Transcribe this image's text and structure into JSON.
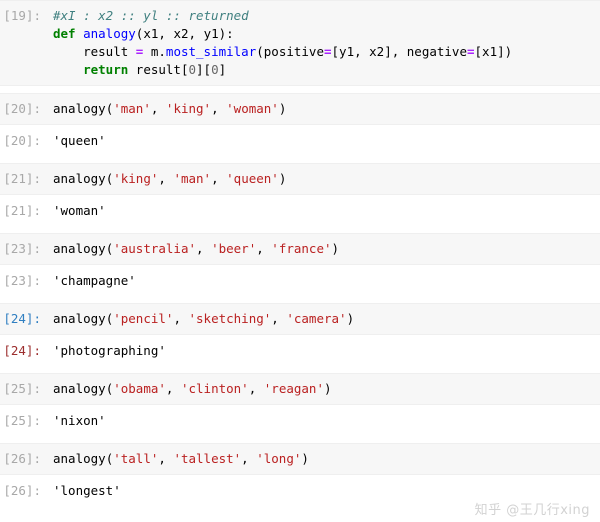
{
  "notebook": {
    "watermark": "知乎 @王几行xing",
    "colors": {
      "input_background": "#f7f7f7",
      "output_background": "#ffffff",
      "prompt_default": "#a8a8a8",
      "prompt_active_input": "#307fc1",
      "prompt_active_output": "#9c2e2e",
      "comment": "#408080",
      "keyword": "#008000",
      "function_name": "#0000ff",
      "string": "#ba2121",
      "operator": "#aa22ff",
      "number": "#666666",
      "watermark": "#d2d2d2"
    },
    "cells": [
      {
        "type": "input",
        "prompt": "[19]:",
        "active": false,
        "lines": [
          [
            {
              "t": "#xI : x2 :: yl :: returned",
              "c": "tok-c"
            }
          ],
          [
            {
              "t": "def",
              "c": "tok-k"
            },
            {
              "t": " ",
              "c": "tok-p"
            },
            {
              "t": "analogy",
              "c": "tok-nf"
            },
            {
              "t": "(",
              "c": "tok-p"
            },
            {
              "t": "x1",
              "c": "tok-n"
            },
            {
              "t": ", ",
              "c": "tok-p"
            },
            {
              "t": "x2",
              "c": "tok-n"
            },
            {
              "t": ", ",
              "c": "tok-p"
            },
            {
              "t": "y1",
              "c": "tok-n"
            },
            {
              "t": "):",
              "c": "tok-p"
            }
          ],
          [
            {
              "t": "    result ",
              "c": "tok-n"
            },
            {
              "t": "=",
              "c": "tok-o"
            },
            {
              "t": " m",
              "c": "tok-n"
            },
            {
              "t": ".",
              "c": "tok-p"
            },
            {
              "t": "most_similar",
              "c": "tok-nf"
            },
            {
              "t": "(",
              "c": "tok-p"
            },
            {
              "t": "positive",
              "c": "tok-na"
            },
            {
              "t": "=",
              "c": "tok-o"
            },
            {
              "t": "[y1, x2], ",
              "c": "tok-p"
            },
            {
              "t": "negative",
              "c": "tok-na"
            },
            {
              "t": "=",
              "c": "tok-o"
            },
            {
              "t": "[x1])",
              "c": "tok-p"
            }
          ],
          [
            {
              "t": "    ",
              "c": "tok-p"
            },
            {
              "t": "return",
              "c": "tok-k"
            },
            {
              "t": " result",
              "c": "tok-n"
            },
            {
              "t": "[",
              "c": "tok-p"
            },
            {
              "t": "0",
              "c": "tok-mi"
            },
            {
              "t": "][",
              "c": "tok-p"
            },
            {
              "t": "0",
              "c": "tok-mi"
            },
            {
              "t": "]",
              "c": "tok-p"
            }
          ]
        ]
      },
      {
        "type": "input",
        "prompt": "[20]:",
        "active": false,
        "lines": [
          [
            {
              "t": "analogy",
              "c": "tok-n"
            },
            {
              "t": "(",
              "c": "tok-p"
            },
            {
              "t": "'man'",
              "c": "tok-s"
            },
            {
              "t": ", ",
              "c": "tok-p"
            },
            {
              "t": "'king'",
              "c": "tok-s"
            },
            {
              "t": ", ",
              "c": "tok-p"
            },
            {
              "t": "'woman'",
              "c": "tok-s"
            },
            {
              "t": ")",
              "c": "tok-p"
            }
          ]
        ]
      },
      {
        "type": "output",
        "prompt": "[20]:",
        "active": false,
        "lines": [
          [
            {
              "t": "'queen'",
              "c": "tok-p"
            }
          ]
        ]
      },
      {
        "type": "input",
        "prompt": "[21]:",
        "active": false,
        "lines": [
          [
            {
              "t": "analogy",
              "c": "tok-n"
            },
            {
              "t": "(",
              "c": "tok-p"
            },
            {
              "t": "'king'",
              "c": "tok-s"
            },
            {
              "t": ", ",
              "c": "tok-p"
            },
            {
              "t": "'man'",
              "c": "tok-s"
            },
            {
              "t": ", ",
              "c": "tok-p"
            },
            {
              "t": "'queen'",
              "c": "tok-s"
            },
            {
              "t": ")",
              "c": "tok-p"
            }
          ]
        ]
      },
      {
        "type": "output",
        "prompt": "[21]:",
        "active": false,
        "lines": [
          [
            {
              "t": "'woman'",
              "c": "tok-p"
            }
          ]
        ]
      },
      {
        "type": "input",
        "prompt": "[23]:",
        "active": false,
        "lines": [
          [
            {
              "t": "analogy",
              "c": "tok-n"
            },
            {
              "t": "(",
              "c": "tok-p"
            },
            {
              "t": "'australia'",
              "c": "tok-s"
            },
            {
              "t": ", ",
              "c": "tok-p"
            },
            {
              "t": "'beer'",
              "c": "tok-s"
            },
            {
              "t": ", ",
              "c": "tok-p"
            },
            {
              "t": "'france'",
              "c": "tok-s"
            },
            {
              "t": ")",
              "c": "tok-p"
            }
          ]
        ]
      },
      {
        "type": "output",
        "prompt": "[23]:",
        "active": false,
        "lines": [
          [
            {
              "t": "'champagne'",
              "c": "tok-p"
            }
          ]
        ]
      },
      {
        "type": "input",
        "prompt": "[24]:",
        "active": true,
        "lines": [
          [
            {
              "t": "analogy",
              "c": "tok-n"
            },
            {
              "t": "(",
              "c": "tok-p"
            },
            {
              "t": "'pencil'",
              "c": "tok-s"
            },
            {
              "t": ", ",
              "c": "tok-p"
            },
            {
              "t": "'sketching'",
              "c": "tok-s"
            },
            {
              "t": ", ",
              "c": "tok-p"
            },
            {
              "t": "'camera'",
              "c": "tok-s"
            },
            {
              "t": ")",
              "c": "tok-p"
            }
          ]
        ]
      },
      {
        "type": "output",
        "prompt": "[24]:",
        "active": true,
        "lines": [
          [
            {
              "t": "'photographing'",
              "c": "tok-p"
            }
          ]
        ]
      },
      {
        "type": "input",
        "prompt": "[25]:",
        "active": false,
        "lines": [
          [
            {
              "t": "analogy",
              "c": "tok-n"
            },
            {
              "t": "(",
              "c": "tok-p"
            },
            {
              "t": "'obama'",
              "c": "tok-s"
            },
            {
              "t": ", ",
              "c": "tok-p"
            },
            {
              "t": "'clinton'",
              "c": "tok-s"
            },
            {
              "t": ", ",
              "c": "tok-p"
            },
            {
              "t": "'reagan'",
              "c": "tok-s"
            },
            {
              "t": ")",
              "c": "tok-p"
            }
          ]
        ]
      },
      {
        "type": "output",
        "prompt": "[25]:",
        "active": false,
        "lines": [
          [
            {
              "t": "'nixon'",
              "c": "tok-p"
            }
          ]
        ]
      },
      {
        "type": "input",
        "prompt": "[26]:",
        "active": false,
        "lines": [
          [
            {
              "t": "analogy",
              "c": "tok-n"
            },
            {
              "t": "(",
              "c": "tok-p"
            },
            {
              "t": "'tall'",
              "c": "tok-s"
            },
            {
              "t": ", ",
              "c": "tok-p"
            },
            {
              "t": "'tallest'",
              "c": "tok-s"
            },
            {
              "t": ", ",
              "c": "tok-p"
            },
            {
              "t": "'long'",
              "c": "tok-s"
            },
            {
              "t": ")",
              "c": "tok-p"
            }
          ]
        ]
      },
      {
        "type": "output",
        "prompt": "[26]:",
        "active": false,
        "lines": [
          [
            {
              "t": "'longest'",
              "c": "tok-p"
            }
          ]
        ]
      }
    ]
  }
}
